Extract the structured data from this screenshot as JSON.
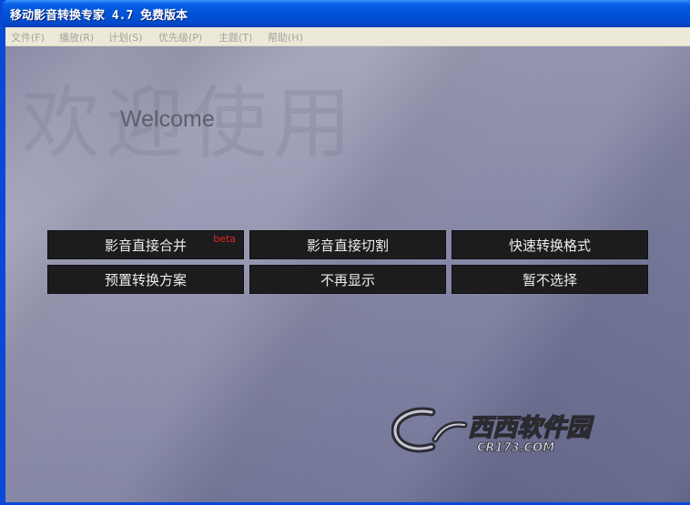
{
  "window": {
    "title": "移动影音转换专家 4.7 免费版本"
  },
  "menu": {
    "items": [
      {
        "label": "文件(F)"
      },
      {
        "label": "播放(R)"
      },
      {
        "label": "计划(S)"
      },
      {
        "label": "优先级(P)"
      },
      {
        "label": "主题(T)"
      },
      {
        "label": "帮助(H)"
      }
    ]
  },
  "main": {
    "watermark": "欢迎使用",
    "welcome": "Welcome",
    "buttons": {
      "merge": "影音直接合并",
      "merge_badge": "beta",
      "cut": "影音直接切割",
      "quick_convert": "快速转换格式",
      "preset": "预置转换方案",
      "dont_show": "不再显示",
      "skip": "暂不选择"
    },
    "logo": {
      "brand": "西西软件园",
      "domain": "CR173.COM"
    }
  },
  "colors": {
    "titlebar": "#0153d8",
    "menubar": "#ece9d8",
    "button_bg": "#1c1c1e",
    "beta": "#e02020"
  }
}
